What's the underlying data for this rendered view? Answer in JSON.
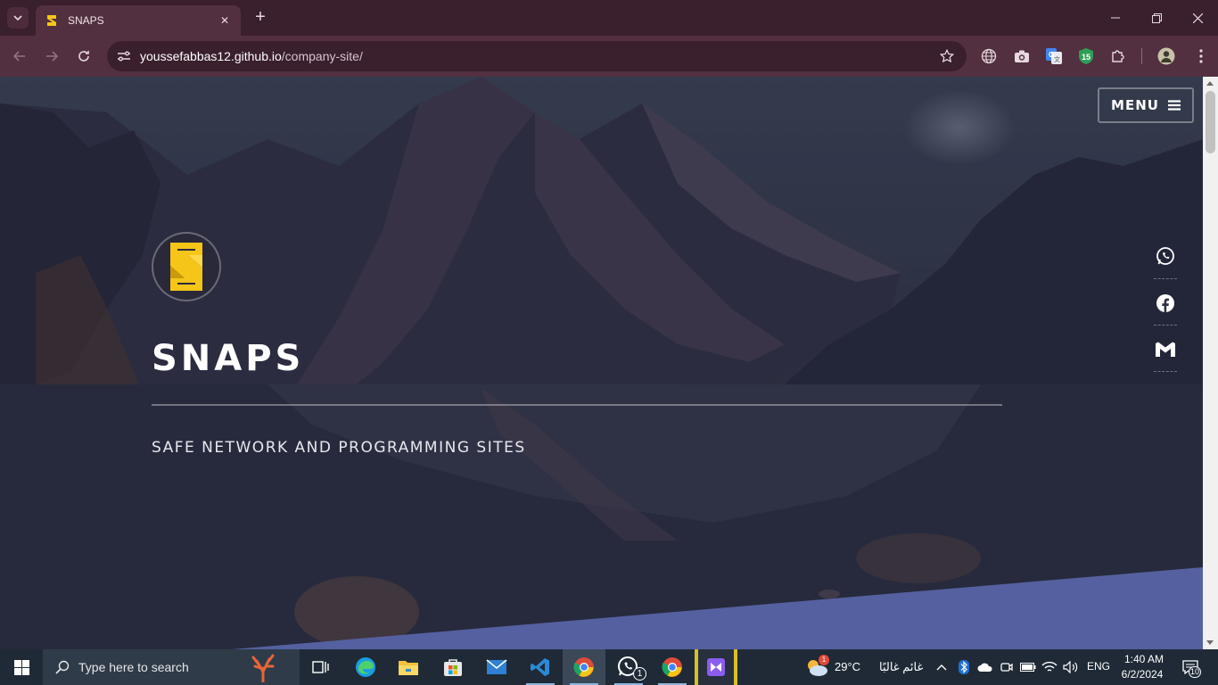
{
  "browser": {
    "tab": {
      "title": "SNAPS",
      "favicon": "snaps-logo-icon"
    },
    "url": {
      "host": "youssefabbas12.github.io",
      "path": "/company-site/"
    }
  },
  "page": {
    "menu_label": "MENU",
    "brand": "SNAPS",
    "tagline": "SAFE NETWORK AND PROGRAMMING SITES",
    "social": [
      "whatsapp-icon",
      "facebook-icon",
      "gmail-icon"
    ],
    "accent_color": "#5560a0",
    "logo_color": "#f5c518"
  },
  "taskbar": {
    "search_placeholder": "Type here to search",
    "weather_temp": "29°C",
    "weather_text": "غائم غالبًا",
    "weather_badge": "1",
    "language": "ENG",
    "time": "1:40 AM",
    "date": "6/2/2024",
    "notification_count": "10",
    "whatsapp_badge": "1"
  }
}
